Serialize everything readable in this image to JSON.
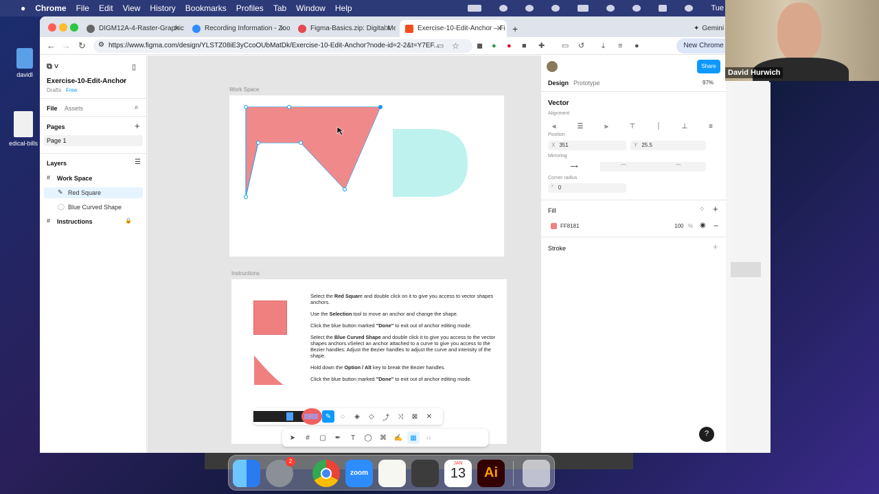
{
  "menubar": {
    "app": "Chrome",
    "items": [
      "File",
      "Edit",
      "View",
      "History",
      "Bookmarks",
      "Profiles",
      "Tab",
      "Window",
      "Help"
    ],
    "clock": "Tue"
  },
  "desktop": {
    "icons": [
      "davidl",
      "edical-bills"
    ]
  },
  "browser": {
    "tabs": [
      {
        "title": "DIGM12A-4-Raster-Graphics"
      },
      {
        "title": "Recording Information - Zoom"
      },
      {
        "title": "Figma-Basics.zip: Digital Me"
      },
      {
        "title": "Exercise-10-Edit-Anchor – Fi"
      }
    ],
    "gemini": "Gemini",
    "url": "https://www.figma.com/design/YLSTZ08iE3yCcoOUbMatDk/Exercise-10-Edit-Anchor?node-id=2-2&t=Y7EF...",
    "new_chrome": "New Chrome available"
  },
  "figma": {
    "file_name": "Exercise-10-Edit-Anchor",
    "drafts": "Drafts",
    "plan": "Free",
    "tab_file": "File",
    "tab_assets": "Assets",
    "pages_title": "Pages",
    "page1": "Page 1",
    "layers_title": "Layers",
    "layers": [
      {
        "name": "Work Space"
      },
      {
        "name": "Red Square"
      },
      {
        "name": "Blue Curved Shape"
      },
      {
        "name": "Instructions"
      }
    ],
    "canvas": {
      "frame1_label": "Work Space",
      "frame2_label": "Instructions",
      "instructions": [
        {
          "pre": "Select the ",
          "bold": "Red Squar",
          "post": "e and double click on it to give you access to vector shapes anchors."
        },
        {
          "pre": "Use the ",
          "bold": "Selection",
          "post": " tool to move an anchor and change the shape."
        },
        {
          "pre": "Click the blue button marked ",
          "bold": "\"Done\"",
          "post": " to exit out of anchor editing mode."
        },
        {
          "pre": "Select the ",
          "bold": "Blue Curved Shape",
          "post": " and double click it to give you access to the vector shapes anchors.vSelect an anchor attached to a curve to give you access to the Bezier handles. Adjust the Bezier handles to adjust the curve and intensity of the shape."
        },
        {
          "pre": "Hold down the ",
          "bold": "Option / Alt",
          "post": " key to break the Bezier handles."
        },
        {
          "pre": "Click the blue button marked ",
          "bold": "\"Done\"",
          "post": " to exit out of anchor editing mode."
        }
      ]
    },
    "right": {
      "share": "Share",
      "tab_design": "Design",
      "tab_prototype": "Prototype",
      "zoom": "97%",
      "selection_title": "Vector",
      "alignment_label": "Alignment",
      "position_label": "Position",
      "x_label": "X",
      "x_value": "351",
      "y_label": "Y",
      "y_value": "25.5",
      "mirroring_label": "Mirroring",
      "corner_label": "Corner radius",
      "corner_value": "0",
      "fill_title": "Fill",
      "fill_hex": "FF8181",
      "fill_opacity": "100",
      "fill_pct": "%",
      "stroke_title": "Stroke",
      "help": "?"
    },
    "colors": {
      "fill": "#FF8181",
      "blue_shape": "#BDF2EE",
      "accent": "#0D99FF"
    }
  },
  "webcam": {
    "name": "David Hurwich"
  },
  "dock": {
    "calendar_month": "JAN",
    "calendar_day": "13",
    "zoom_label": "zoom",
    "badge": "2",
    "ai": "Ai"
  }
}
